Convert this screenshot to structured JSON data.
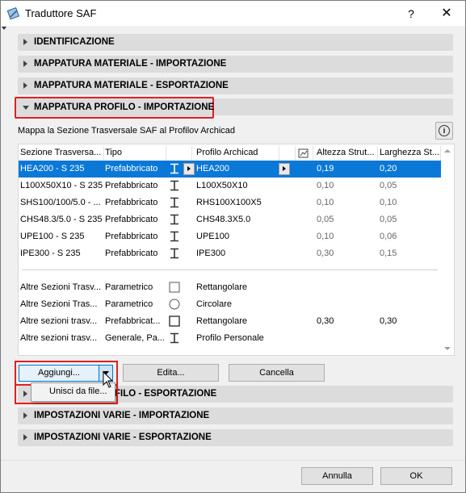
{
  "window": {
    "title": "Traduttore SAF",
    "help": "?",
    "close": "✕"
  },
  "sections": {
    "s1": "IDENTIFICAZIONE",
    "s2": "MAPPATURA MATERIALE - IMPORTAZIONE",
    "s3": "MAPPATURA MATERIALE - ESPORTAZIONE",
    "s4": "MAPPATURA PROFILO - IMPORTAZIONE",
    "s5_visible": "FILO - ESPORTAZIONE",
    "s6": "IMPOSTAZIONI VARIE - IMPORTAZIONE",
    "s7": "IMPOSTAZIONI VARIE - ESPORTAZIONE"
  },
  "description": "Mappa la Sezione Trasversale SAF al Profilov Archicad",
  "table": {
    "headers": [
      "Sezione Trasversa...",
      "Tipo",
      "Profilo Archicad",
      "Altezza Strut...",
      "Larghezza St..."
    ],
    "rows": [
      {
        "section": "HEA200 - S 235",
        "type": "Prefabbricato",
        "shape": "i-beam",
        "profile": "HEA200",
        "height": "0,19",
        "width": "0,20",
        "selected": true
      },
      {
        "section": "L100X50X10 - S 235",
        "type": "Prefabbricato",
        "shape": "i-beam",
        "profile": "L100X50X10",
        "height": "0,10",
        "width": "0,05"
      },
      {
        "section": "SHS100/100/5.0 - ...",
        "type": "Prefabbricato",
        "shape": "i-beam",
        "profile": "RHS100X100X5",
        "height": "0,10",
        "width": "0,10"
      },
      {
        "section": "CHS48.3/5.0 - S 235",
        "type": "Prefabbricato",
        "shape": "i-beam",
        "profile": "CHS48.3X5.0",
        "height": "0,05",
        "width": "0,05"
      },
      {
        "section": "UPE100 - S 235",
        "type": "Prefabbricato",
        "shape": "i-beam",
        "profile": "UPE100",
        "height": "0,10",
        "width": "0,06"
      },
      {
        "section": "IPE300 - S 235",
        "type": "Prefabbricato",
        "shape": "i-beam",
        "profile": "IPE300",
        "height": "0,30",
        "width": "0,15"
      }
    ],
    "other_rows": [
      {
        "section": "Altre Sezioni Trasv...",
        "type": "Parametrico",
        "shape": "square",
        "profile": "Rettangolare",
        "height": "",
        "width": ""
      },
      {
        "section": "Altre Sezioni Tras...",
        "type": "Parametrico",
        "shape": "circle",
        "profile": "Circolare",
        "height": "",
        "width": ""
      },
      {
        "section": "Altre sezioni trasv...",
        "type": "Prefabbricat...",
        "shape": "square",
        "profile": "Rettangolare",
        "height": "0,30",
        "width": "0,30"
      },
      {
        "section": "Altre sezioni trasv...",
        "type": "Generale, Pa...",
        "shape": "i-beam",
        "profile": "Profilo Personale",
        "height": "",
        "width": ""
      }
    ]
  },
  "buttons": {
    "add": "Aggiungi...",
    "edit": "Edita...",
    "delete": "Cancella",
    "cancel": "Annulla",
    "ok": "OK"
  },
  "dropdown_menu": {
    "item": "Unisci da file..."
  },
  "colors": {
    "selection": "#0a78d7",
    "highlight": "#e02020",
    "accent": "#0078d7"
  }
}
